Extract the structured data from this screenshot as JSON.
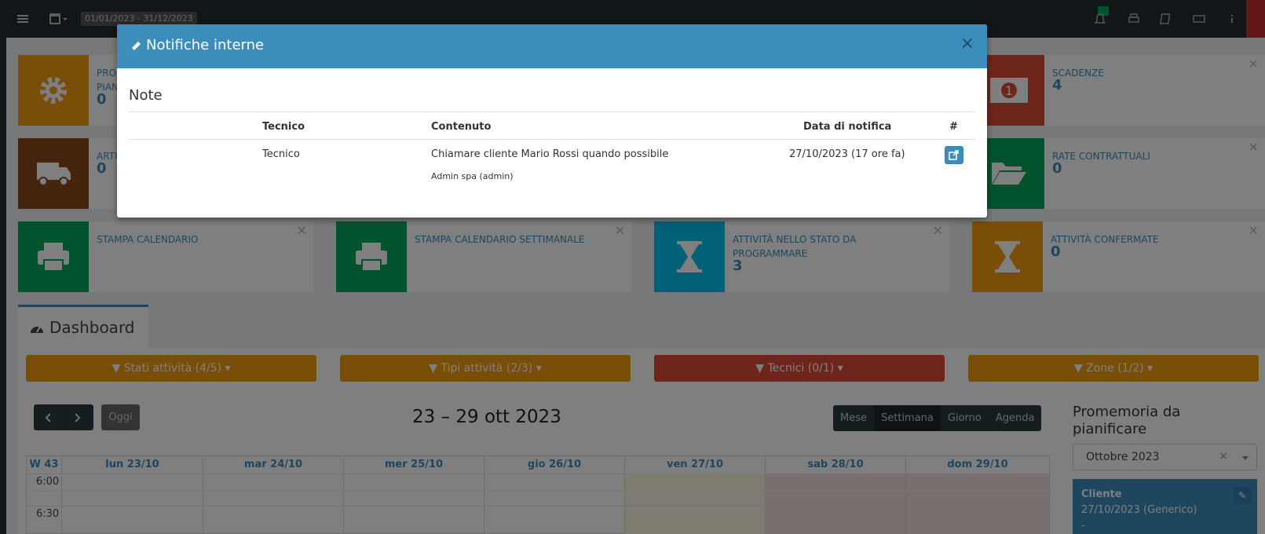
{
  "topbar": {
    "daterange": "01/01/2023 - 31/12/2023",
    "icons": [
      "menu-icon",
      "calendar-icon",
      "bell-icon",
      "print-icon",
      "book-icon",
      "keyboard-icon",
      "info-icon",
      "power-icon"
    ]
  },
  "info_boxes": [
    {
      "title": "PRO",
      "title2": "PIAN",
      "value": "0",
      "color": "#f39c12"
    },
    {
      "title": "SCADENZE",
      "value": "4",
      "color": "#dd4b39"
    },
    {
      "title": "ARTI",
      "value": "0",
      "color": "#8a4a1b"
    },
    {
      "title": "RATE CONTRATTUALI",
      "value": "0",
      "color": "#00a65a"
    },
    {
      "title": "STAMPA CALENDARIO",
      "value": "",
      "color": "#00a65a"
    },
    {
      "title": "STAMPA CALENDARIO SETTIMANALE",
      "value": "",
      "color": "#00a65a"
    },
    {
      "title": "ATTIVITÀ NELLO STATO DA PROGRAMMARE",
      "value": "3",
      "color": "#00c0ef"
    },
    {
      "title": "ATTIVITÀ CONFERMATE",
      "value": "0",
      "color": "#f39c12"
    }
  ],
  "dashboard": {
    "tab_label": "Dashboard",
    "filters": [
      {
        "label": "Stati attività (4/5)",
        "color": "#f39c12"
      },
      {
        "label": "Tipi attività (2/3)",
        "color": "#f39c12"
      },
      {
        "label": "Tecnici (0/1)",
        "color": "#dd4b39"
      },
      {
        "label": "Zone (1/2)",
        "color": "#f39c12"
      }
    ],
    "today_label": "Oggi",
    "calendar_title": "23 – 29 ott 2023",
    "views": [
      "Mese",
      "Settimana",
      "Giorno",
      "Agenda"
    ],
    "active_view": "Settimana",
    "week_label": "W 43",
    "days": [
      "lun 23/10",
      "mar 24/10",
      "mer 25/10",
      "gio 26/10",
      "ven 27/10",
      "sab 28/10",
      "dom 29/10"
    ],
    "times": [
      "6:00",
      "6:30"
    ]
  },
  "promemoria": {
    "title": "Promemoria da pianificare",
    "month": "Ottobre 2023",
    "clear": "×",
    "reminder_title": "Cliente",
    "reminder_date": "27/10/2023 (Generico)",
    "reminder_dash": "-"
  },
  "modal": {
    "title": "Notifiche interne",
    "close": "×",
    "section_title": "Note",
    "headers": {
      "tecnico": "Tecnico",
      "contenuto": "Contenuto",
      "data": "Data di notifica",
      "hash": "#"
    },
    "rows": [
      {
        "tecnico": "Tecnico",
        "contenuto": "Chiamare cliente Mario Rossi quando possibile",
        "autore": "Admin spa (admin)",
        "data": "27/10/2023 (17 ore fa)"
      }
    ]
  }
}
